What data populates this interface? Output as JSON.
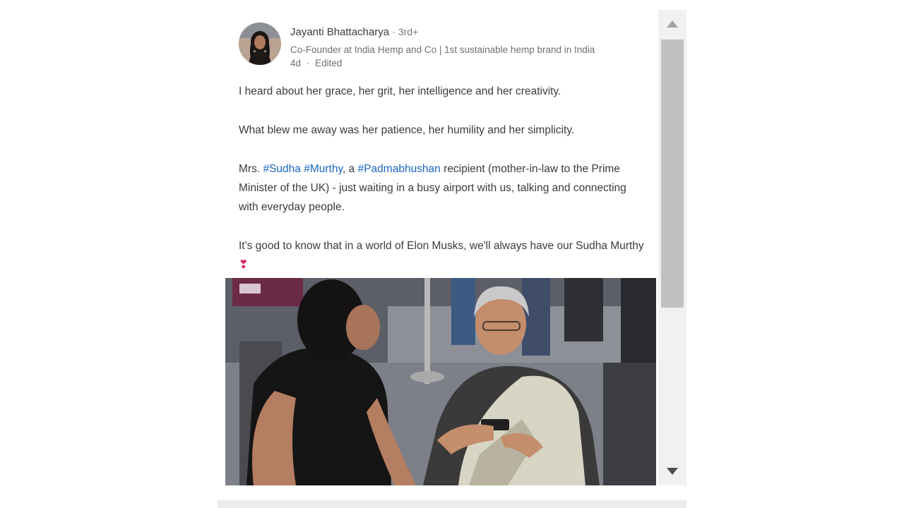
{
  "post": {
    "author": {
      "name": "Jayanti Bhattacharya",
      "degree": "· 3rd+",
      "headline": "Co-Founder at India Hemp and Co | 1st sustainable hemp brand in India",
      "time": "4d",
      "separator": "·",
      "edited": "Edited"
    },
    "text": {
      "p1": "I heard about her grace, her grit, her intelligence and her creativity.",
      "p2": "What blew me away was her patience, her humility and her simplicity.",
      "p3_part1": "Mrs. ",
      "p3_tag1": "#Sudha",
      "p3_space": " ",
      "p3_tag2": "#Murthy",
      "p3_part2": ", a ",
      "p3_tag3": "#Padmabhushan",
      "p3_part3": " recipient (mother-in-law to the Prime Minister of the UK) - just waiting in a busy airport with us, talking and connecting with everyday people.",
      "p4": "It's good to know that in a world of Elon Musks, we'll always have our Sudha Murthy",
      "p4_emoji": "❣"
    }
  },
  "icons": {
    "scroll_up": "triangle-up-icon",
    "scroll_down": "triangle-down-icon",
    "heart": "heart-exclamation-icon"
  },
  "colors": {
    "hashtag": "#1a66c2",
    "heart": "#e0245e",
    "scroll_thumb": "#c1c1c1",
    "scroll_track": "#f1f1f1"
  }
}
